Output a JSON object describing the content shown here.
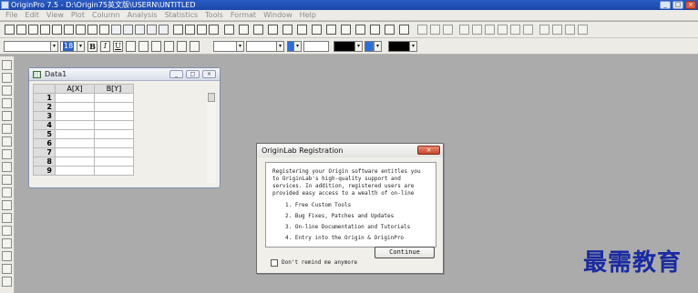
{
  "window": {
    "title": "OriginPro 7.5 - D:\\Origin75英文版\\USERN\\UNTITLED",
    "min": "_",
    "max": "□",
    "close": "×"
  },
  "menu": [
    "File",
    "Edit",
    "View",
    "Plot",
    "Column",
    "Analysis",
    "Statistics",
    "Tools",
    "Format",
    "Window",
    "Help"
  ],
  "format_toolbar": {
    "font_size": "18",
    "bold": "B",
    "italic": "I",
    "underline": "U",
    "dropdown": "▾"
  },
  "worksheet": {
    "title": "Data1",
    "columns": [
      "A[X]",
      "B[Y]"
    ],
    "rows": [
      "1",
      "2",
      "3",
      "4",
      "5",
      "6",
      "7",
      "8",
      "9"
    ]
  },
  "dialog": {
    "title": "OriginLab Registration",
    "close": "×",
    "paragraph": [
      "Registering your Origin software entitles you",
      "to OriginLab's high-quality support and",
      "services. In addition, registered users are",
      "provided easy access to a wealth of on-line"
    ],
    "items": [
      "1. Free Custom Tools",
      "2. Bug Fixes, Patches and Updates",
      "3. On-line Documentation and Tutorials",
      "4. Entry into the Origin & OriginPro"
    ],
    "continue_label": "Continue",
    "remind_label": "Don't remind me anymore"
  },
  "watermark": "最需教育"
}
